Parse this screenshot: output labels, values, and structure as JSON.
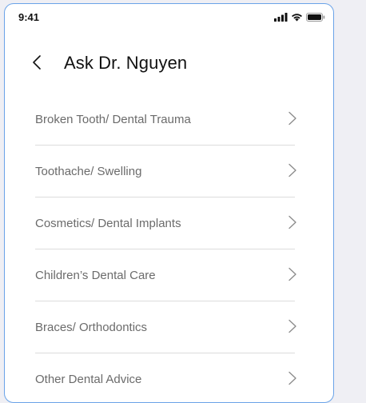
{
  "status_bar": {
    "time": "9:41",
    "icons": [
      "signal-icon",
      "wifi-icon",
      "battery-icon"
    ]
  },
  "header": {
    "title": "Ask Dr. Nguyen",
    "back_icon": "chevron-left-icon"
  },
  "menu": {
    "items": [
      {
        "label": "Broken Tooth/ Dental Trauma"
      },
      {
        "label": "Toothache/ Swelling"
      },
      {
        "label": "Cosmetics/ Dental Implants"
      },
      {
        "label": "Children’s Dental Care"
      },
      {
        "label": "Braces/ Orthodontics"
      },
      {
        "label": "Other Dental Advice"
      }
    ]
  },
  "colors": {
    "frame_border": "#6aa3e8",
    "background": "#efeff4",
    "title_text": "#111111",
    "item_text": "#6b6b6b",
    "divider": "#dcdcdc",
    "chevron": "#8a8a8a"
  }
}
